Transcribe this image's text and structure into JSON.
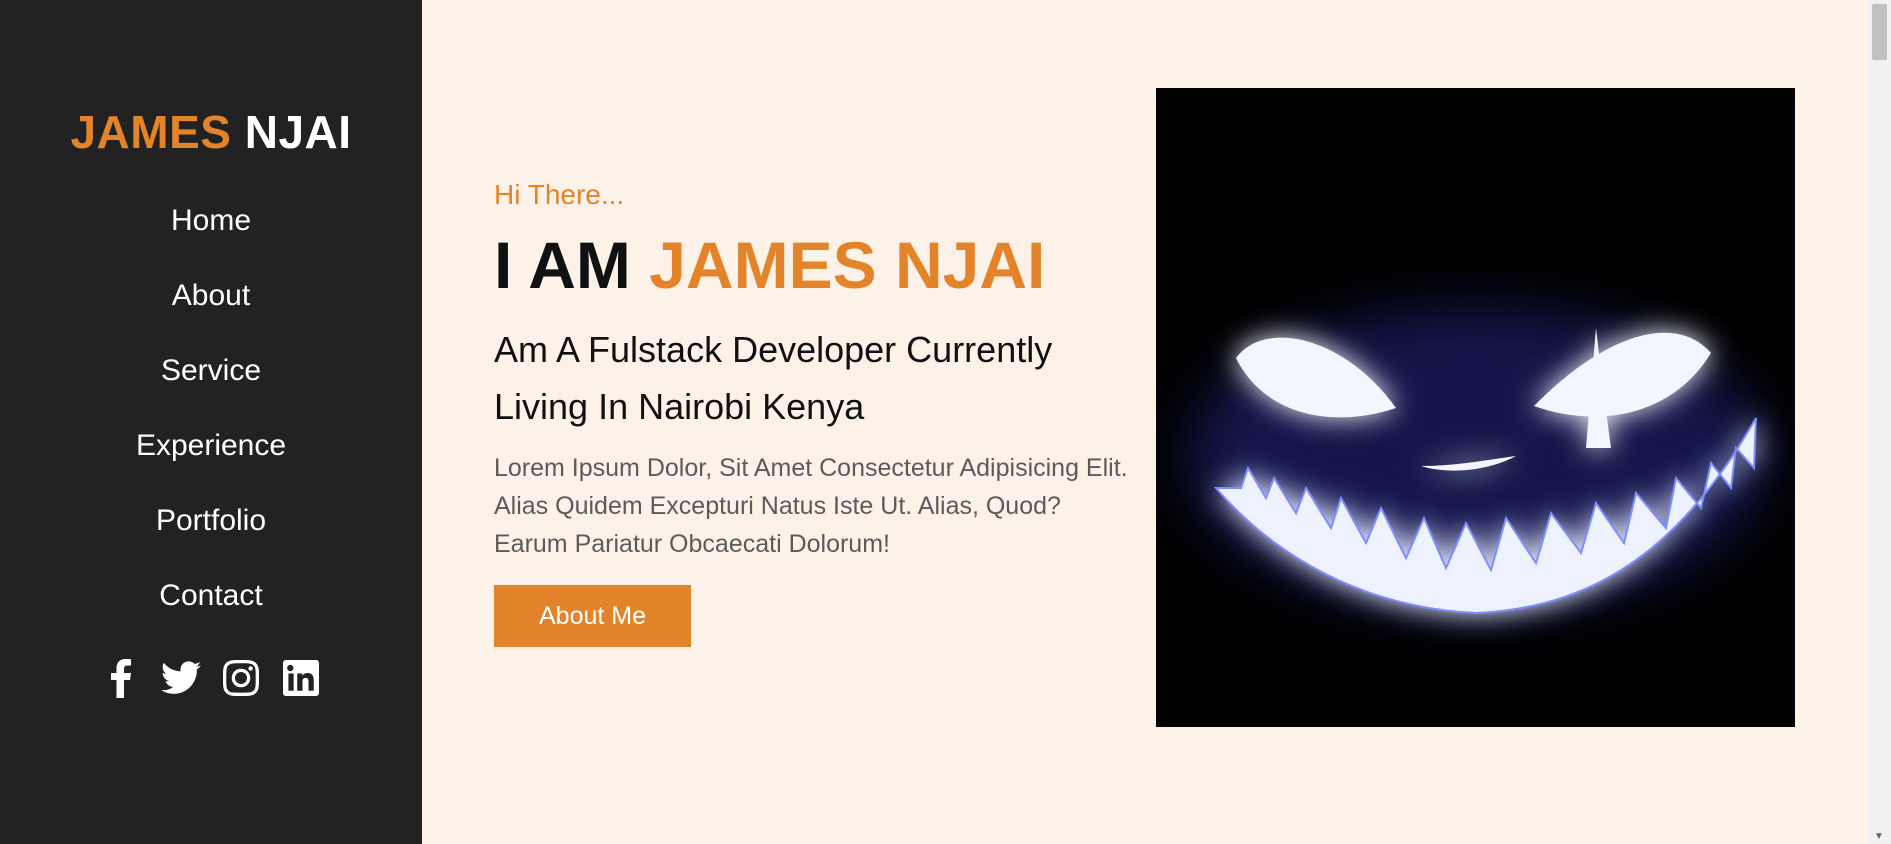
{
  "brand": {
    "first": "JAMES",
    "last": "NJAI"
  },
  "nav": {
    "items": [
      {
        "label": "Home"
      },
      {
        "label": "About"
      },
      {
        "label": "Service"
      },
      {
        "label": "Experience"
      },
      {
        "label": "Portfolio"
      },
      {
        "label": "Contact"
      }
    ]
  },
  "social": [
    "facebook-icon",
    "twitter-icon",
    "instagram-icon",
    "linkedin-icon"
  ],
  "hero": {
    "greeting": "Hi There...",
    "headline_prefix": "I AM",
    "headline_name": "JAMES NJAI",
    "subheadline": "Am A Fulstack Developer Currently Living In Nairobi Kenya",
    "description": "Lorem Ipsum Dolor, Sit Amet Consectetur Adipisicing Elit. Alias Quidem Excepturi Natus Iste Ut. Alias, Quod? Earum Pariatur Obcaecati Dolorum!",
    "button_label": "About Me"
  },
  "colors": {
    "accent": "#e3842b",
    "sidebar_bg": "#222222",
    "page_bg": "#fdf2e8",
    "glow": "#4a5cff"
  }
}
